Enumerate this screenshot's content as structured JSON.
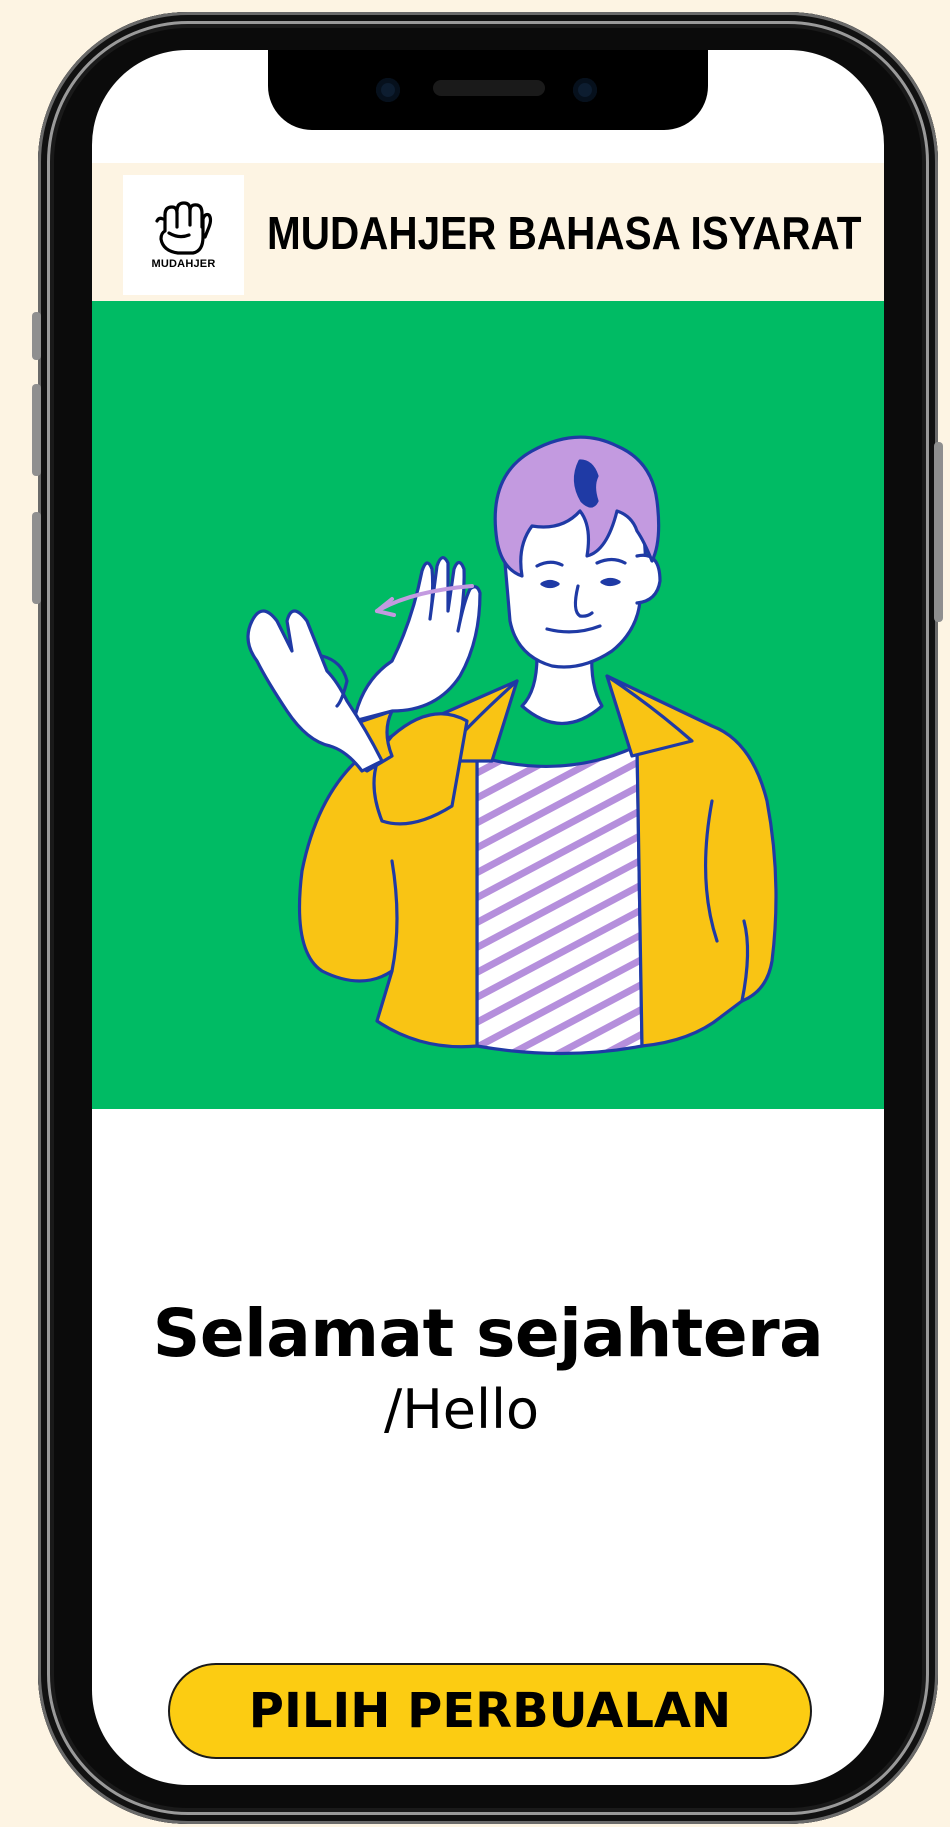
{
  "header": {
    "logo_text": "MUDAHJER",
    "title": "MUDAHJER BAHASA ISYARAT"
  },
  "hero": {
    "illustration": "person-signing-hello",
    "background_color": "#00bb64"
  },
  "sign": {
    "word": "Selamat sejahtera",
    "translation": "/Hello"
  },
  "cta": {
    "label": "PILIH PERBUALAN",
    "color": "#fccc12"
  },
  "colors": {
    "page_bg": "#fdf4e3",
    "header_bg": "#fdf4e3",
    "hair": "#c39ae0",
    "jacket": "#f9c414",
    "outline": "#1f3aa5"
  }
}
